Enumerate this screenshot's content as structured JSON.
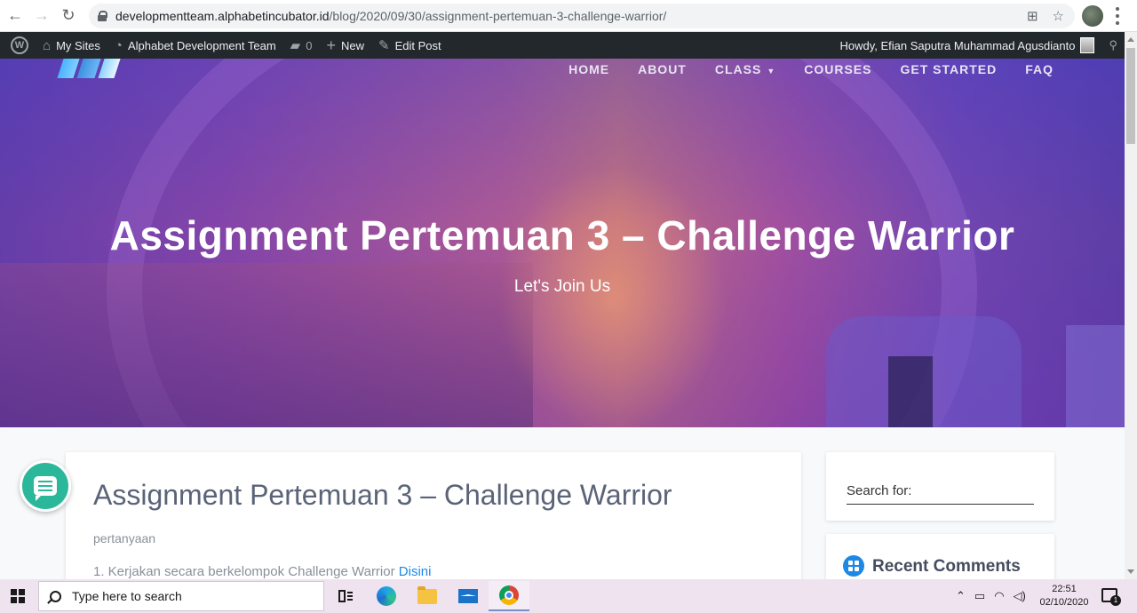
{
  "browser": {
    "url_host": "developmentteam.alphabetincubator.id",
    "url_path": "/blog/2020/09/30/assignment-pertemuan-3-challenge-warrior/"
  },
  "adminbar": {
    "my_sites": "My Sites",
    "site_name": "Alphabet Development Team",
    "comments_count": "0",
    "new_label": "New",
    "edit_post": "Edit Post",
    "howdy": "Howdy, Efian Saputra Muhammad Agusdianto"
  },
  "nav": {
    "home": "HOME",
    "about": "ABOUT",
    "class": "CLASS",
    "courses": "COURSES",
    "get_started": "GET STARTED",
    "faq": "FAQ"
  },
  "hero": {
    "title": "Assignment Pertemuan 3 – Challenge Warrior",
    "subtitle": "Let's Join Us"
  },
  "post": {
    "title": "Assignment Pertemuan 3 – Challenge Warrior",
    "paragraph": "pertanyaan",
    "item_text": "1. Kerjakan secara berkelompok Challenge Warrior ",
    "item_link": "Disini"
  },
  "sidebar": {
    "search_label": "Search for:",
    "recent_comments": "Recent Comments"
  },
  "taskbar": {
    "search_placeholder": "Type here to search",
    "time": "22:51",
    "date": "02/10/2020",
    "notification_count": "1"
  }
}
